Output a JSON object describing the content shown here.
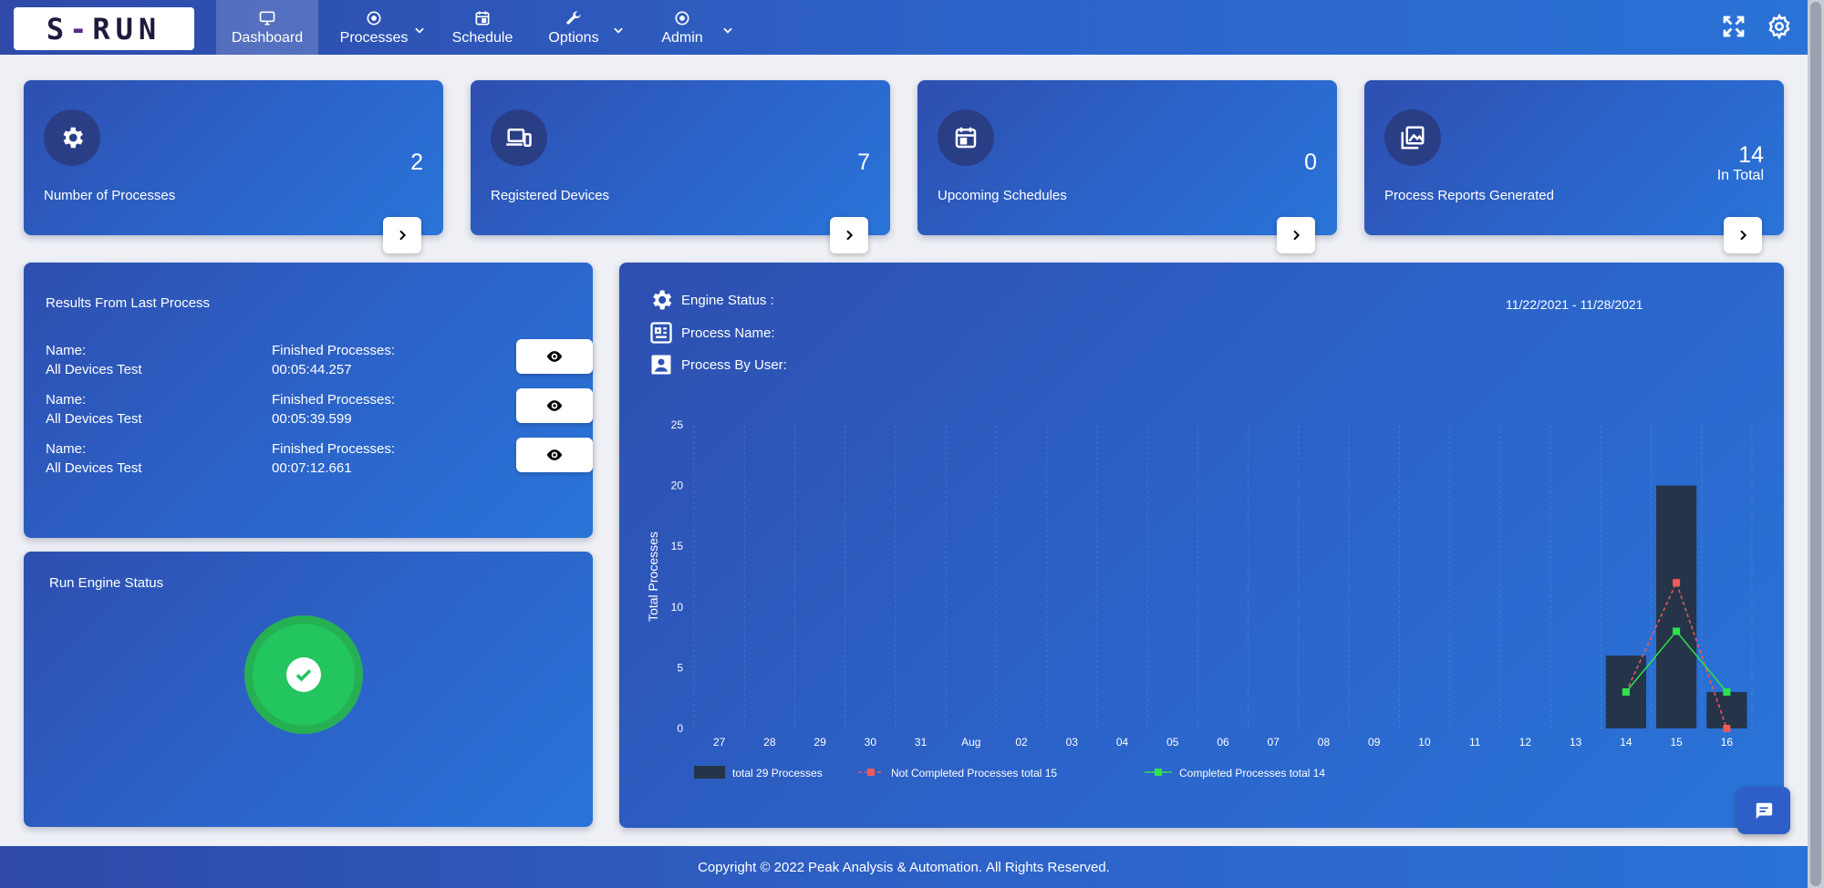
{
  "app": {
    "logo_left": "S",
    "logo_dash": "-",
    "logo_right": "RUN"
  },
  "nav": {
    "items": [
      {
        "label": "Dashboard",
        "icon": "monitor-icon"
      },
      {
        "label": "Processes",
        "icon": "process-icon"
      },
      {
        "label": "Schedule",
        "icon": "calendar-icon"
      },
      {
        "label": "Options",
        "icon": "wrench-icon"
      },
      {
        "label": "Admin",
        "icon": "admin-icon"
      }
    ]
  },
  "stats": [
    {
      "label": "Number of Processes",
      "value": "2",
      "icon": "gear-icon"
    },
    {
      "label": "Registered Devices",
      "value": "7",
      "icon": "devices-icon"
    },
    {
      "label": "Upcoming Schedules",
      "value": "0",
      "icon": "calendar-icon"
    },
    {
      "label": "Process Reports Generated",
      "value": "14",
      "sub": "In Total",
      "icon": "gallery-icon"
    }
  ],
  "results": {
    "title": "Results From Last Process",
    "rows": [
      {
        "name_label": "Name:",
        "name": "All Devices Test",
        "time_label": "Finished Processes:",
        "time": "00:05:44.257"
      },
      {
        "name_label": "Name:",
        "name": "All Devices Test",
        "time_label": "Finished Processes:",
        "time": "00:05:39.599"
      },
      {
        "name_label": "Name:",
        "name": "All Devices Test",
        "time_label": "Finished Processes:",
        "time": "00:07:12.661"
      }
    ]
  },
  "engine": {
    "title": "Run Engine Status",
    "status": "ok"
  },
  "chart_panel": {
    "engine_status_label": "Engine Status :",
    "process_name_label": "Process Name:",
    "process_by_user_label": "Process By User:",
    "date_range": "11/22/2021 - 11/28/2021"
  },
  "chart_data": {
    "type": "bar",
    "categories": [
      "27",
      "28",
      "29",
      "30",
      "31",
      "Aug",
      "02",
      "03",
      "04",
      "05",
      "06",
      "07",
      "08",
      "09",
      "10",
      "11",
      "12",
      "13",
      "14",
      "15",
      "16"
    ],
    "ylabel": "Total Processes",
    "ylim": [
      0,
      25
    ],
    "yticks": [
      0,
      5,
      10,
      15,
      20,
      25
    ],
    "grid": true,
    "series": [
      {
        "name": "total 29 Processes",
        "kind": "bar",
        "color": "#253448",
        "values": [
          0,
          0,
          0,
          0,
          0,
          0,
          0,
          0,
          0,
          0,
          0,
          0,
          0,
          0,
          0,
          0,
          0,
          0,
          6,
          20,
          3
        ]
      },
      {
        "name": "Not Completed Processes  total 15",
        "kind": "line-dashed",
        "color": "#f05a5a",
        "values": [
          null,
          null,
          null,
          null,
          null,
          null,
          null,
          null,
          null,
          null,
          null,
          null,
          null,
          null,
          null,
          null,
          null,
          null,
          3,
          12,
          0
        ]
      },
      {
        "name": "Completed Processes  total 14",
        "kind": "line",
        "color": "#2fe24a",
        "values": [
          null,
          null,
          null,
          null,
          null,
          null,
          null,
          null,
          null,
          null,
          null,
          null,
          null,
          null,
          null,
          null,
          null,
          null,
          3,
          8,
          3
        ]
      }
    ],
    "legend_position": "bottom"
  },
  "footer": {
    "prefix": "Copyright © 2022",
    "company": "Peak Analysis & Automation.",
    "suffix": "All Rights Reserved."
  }
}
